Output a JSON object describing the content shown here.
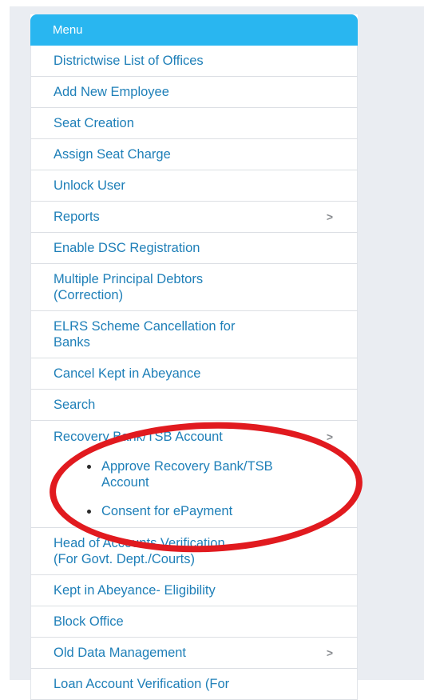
{
  "menu": {
    "header": "Menu",
    "items": [
      {
        "label": "Districtwise List of Offices",
        "arrow": false
      },
      {
        "label": "Add New Employee",
        "arrow": false
      },
      {
        "label": "Seat Creation",
        "arrow": false
      },
      {
        "label": "Assign Seat Charge",
        "arrow": false
      },
      {
        "label": "Unlock User",
        "arrow": false
      },
      {
        "label": "Reports",
        "arrow": true
      },
      {
        "label": "Enable DSC Registration",
        "arrow": false
      },
      {
        "label": "Multiple Principal Debtors\n(Correction)",
        "arrow": false
      },
      {
        "label": "ELRS Scheme Cancellation for\nBanks",
        "arrow": false
      },
      {
        "label": "Cancel Kept in Abeyance",
        "arrow": false
      },
      {
        "label": "Search",
        "arrow": false
      },
      {
        "label": "Recovery Bank/TSB Account",
        "arrow": true
      },
      {
        "label": "Head of Accounts Verification\n(For Govt. Dept./Courts)",
        "arrow": false
      },
      {
        "label": "Kept in Abeyance- Eligibility",
        "arrow": false
      },
      {
        "label": "Block Office",
        "arrow": false
      },
      {
        "label": "Old Data Management",
        "arrow": true
      },
      {
        "label": "Loan Account Verification (For",
        "arrow": false
      }
    ],
    "submenu": [
      "Approve Recovery Bank/TSB\nAccount",
      "Consent for ePayment"
    ]
  },
  "colors": {
    "header_bg": "#29b6f0",
    "link": "#1e7fb8",
    "highlight_ellipse": "#e11a1f"
  },
  "icons": {
    "submenu_arrow": "chevron-right-icon"
  }
}
